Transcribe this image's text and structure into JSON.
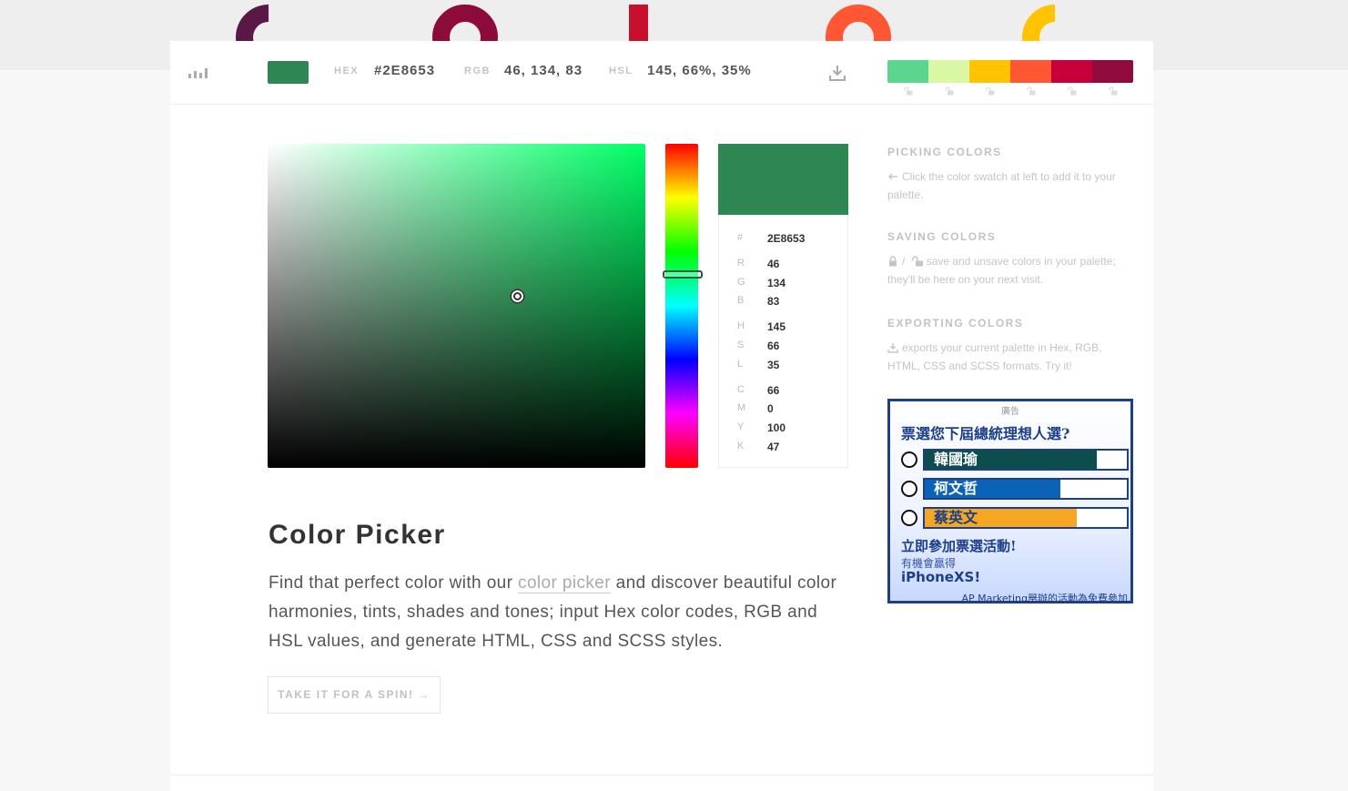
{
  "top_decor": {
    "colors": [
      "#5a1846",
      "#8c0b3a",
      "#c8102e",
      "#ff5733",
      "#ffc300"
    ]
  },
  "toolbar": {
    "current_color": "#2E8653",
    "hex_label": "HEX",
    "hex_value": "#2E8653",
    "rgb_label": "RGB",
    "rgb_value": "46, 134, 83",
    "hsl_label": "HSL",
    "hsl_value": "145, 66%, 35%",
    "palette": [
      "#5cd68f",
      "#daf7a6",
      "#ffc300",
      "#ff5733",
      "#c70039",
      "#900c3f"
    ]
  },
  "picker": {
    "hue_color": "#00ff66",
    "saturation": 0.66,
    "value": 0.53,
    "hue": 145
  },
  "values": {
    "hash_key": "#",
    "hex": "2E8653",
    "rows": [
      {
        "k": "R",
        "v": "46"
      },
      {
        "k": "G",
        "v": "134"
      },
      {
        "k": "B",
        "v": "83"
      },
      {
        "k": "H",
        "v": "145"
      },
      {
        "k": "S",
        "v": "66"
      },
      {
        "k": "L",
        "v": "35"
      },
      {
        "k": "C",
        "v": "66"
      },
      {
        "k": "M",
        "v": "0"
      },
      {
        "k": "Y",
        "v": "100"
      },
      {
        "k": "K",
        "v": "47"
      }
    ]
  },
  "content": {
    "title": "Color Picker",
    "desc_before": "Find that perfect color with our ",
    "desc_link": "color picker",
    "desc_after": " and discover beautiful color harmonies, tints, shades and tones; input Hex color codes, RGB and HSL values, and generate HTML, CSS and SCSS styles.",
    "button": "TAKE IT FOR A SPIN! →"
  },
  "help": {
    "picking_title": "PICKING COLORS",
    "picking_text": "Click the color swatch at left to add it to your palette.",
    "saving_title": "SAVING COLORS",
    "saving_sep": "/",
    "saving_text": "save and unsave colors in your palette; they'll be here on your next visit.",
    "exporting_title": "EXPORTING COLORS",
    "exporting_text": "exports your current palette in Hex, RGB, HTML, CSS and SCSS formats. Try it!"
  },
  "ad": {
    "tag": "廣告",
    "question": "票選您下屆總統理想人選?",
    "options": [
      {
        "label": "韓國瑜",
        "fill": 0.85,
        "color": "#0d4d4d",
        "text_color": "#ffffff"
      },
      {
        "label": "柯文哲",
        "fill": 0.67,
        "color": "#0b63b8",
        "text_color": "#ffffff"
      },
      {
        "label": "蔡英文",
        "fill": 0.75,
        "color": "#f5a623",
        "text_color": "#1c3f8a"
      }
    ],
    "cta": "立即參加票選活動!",
    "sub": "有機會贏得",
    "phone": "iPhoneXS!",
    "footer": "AP Marketing舉辦的活動為免費參加"
  }
}
